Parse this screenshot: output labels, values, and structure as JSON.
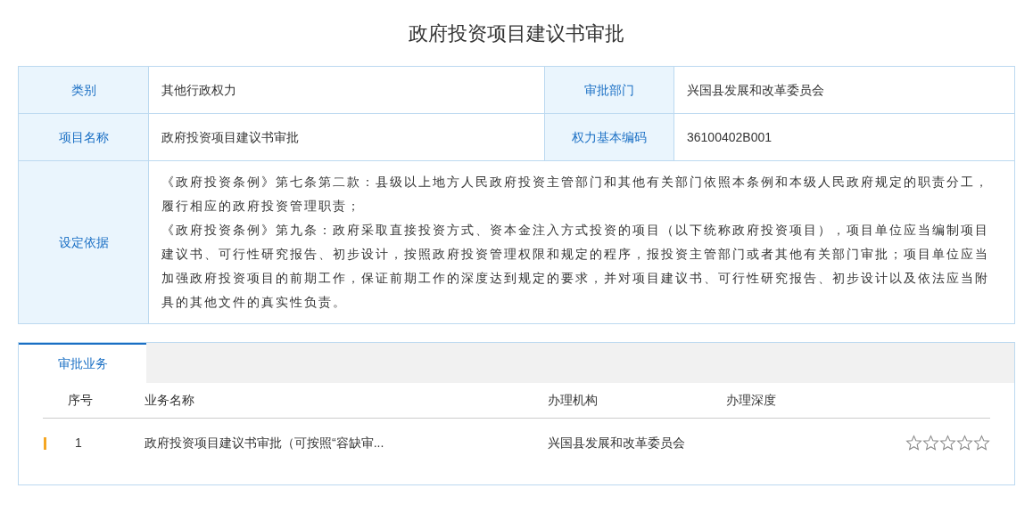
{
  "title": "政府投资项目建议书审批",
  "info_rows": [
    {
      "label": "类别",
      "value": "其他行政权力",
      "label_2": "审批部门",
      "value_2": "兴国县发展和改革委员会"
    },
    {
      "label": "项目名称",
      "value": "政府投资项目建议书审批",
      "label_2": "权力基本编码",
      "value_2": "36100402B001"
    }
  ],
  "basis": {
    "label": "设定依据",
    "paragraphs": [
      "《政府投资条例》第七条第二款：县级以上地方人民政府投资主管部门和其他有关部门依照本条例和本级人民政府规定的职责分工，履行相应的政府投资管理职责；",
      "《政府投资条例》第九条：政府采取直接投资方式、资本金注入方式投资的项目（以下统称政府投资项目），项目单位应当编制项目建议书、可行性研究报告、初步设计，按照政府投资管理权限和规定的程序，报投资主管部门或者其他有关部门审批；项目单位应当加强政府投资项目的前期工作，保证前期工作的深度达到规定的要求，并对项目建议书、可行性研究报告、初步设计以及依法应当附具的其他文件的真实性负责。"
    ]
  },
  "tabs": [
    {
      "label": "审批业务",
      "selected": true
    }
  ],
  "table": {
    "columns": [
      "序号",
      "业务名称",
      "办理机构",
      "办理深度"
    ],
    "rows": [
      {
        "index": "1",
        "name": "政府投资项目建议书审批（可按照“容缺审...",
        "agency": "兴国县发展和改革委员会",
        "stars": 0
      }
    ]
  }
}
